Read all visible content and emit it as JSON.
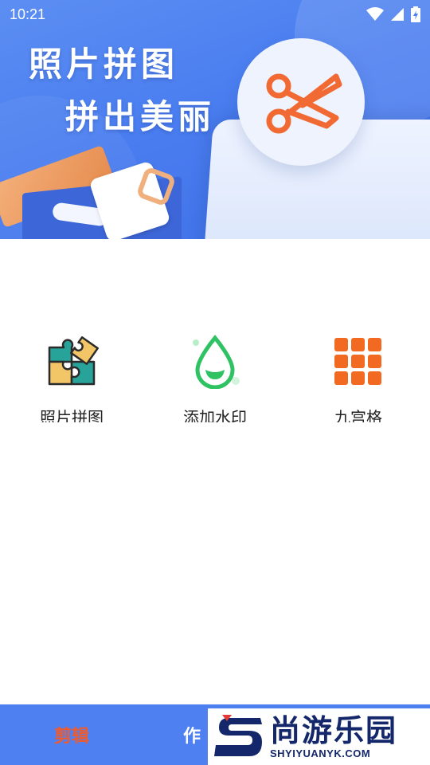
{
  "status_bar": {
    "time": "10:21",
    "icons": [
      "wifi-icon",
      "cell-signal-icon",
      "battery-icon"
    ]
  },
  "banner": {
    "line1": "照片拼图",
    "line2": "拼出美丽",
    "icon": "scissors-icon",
    "colors": {
      "background": "#4a7ef0",
      "scissors": "#f26a33"
    }
  },
  "features": [
    {
      "label": "照片拼图",
      "icon": "puzzle-icon"
    },
    {
      "label": "添加水印",
      "icon": "water-drop-icon"
    },
    {
      "label": "九宫格",
      "icon": "nine-grid-icon"
    }
  ],
  "bottom_nav": {
    "tabs": [
      {
        "label": "剪辑",
        "active": true,
        "color": "#ef5b2c"
      },
      {
        "label": "作",
        "active": false,
        "color": "#ffffff"
      }
    ],
    "background": "#4f80f2"
  },
  "watermark": {
    "title": "尚游乐园",
    "url": "SHYIYUANYK.COM"
  }
}
